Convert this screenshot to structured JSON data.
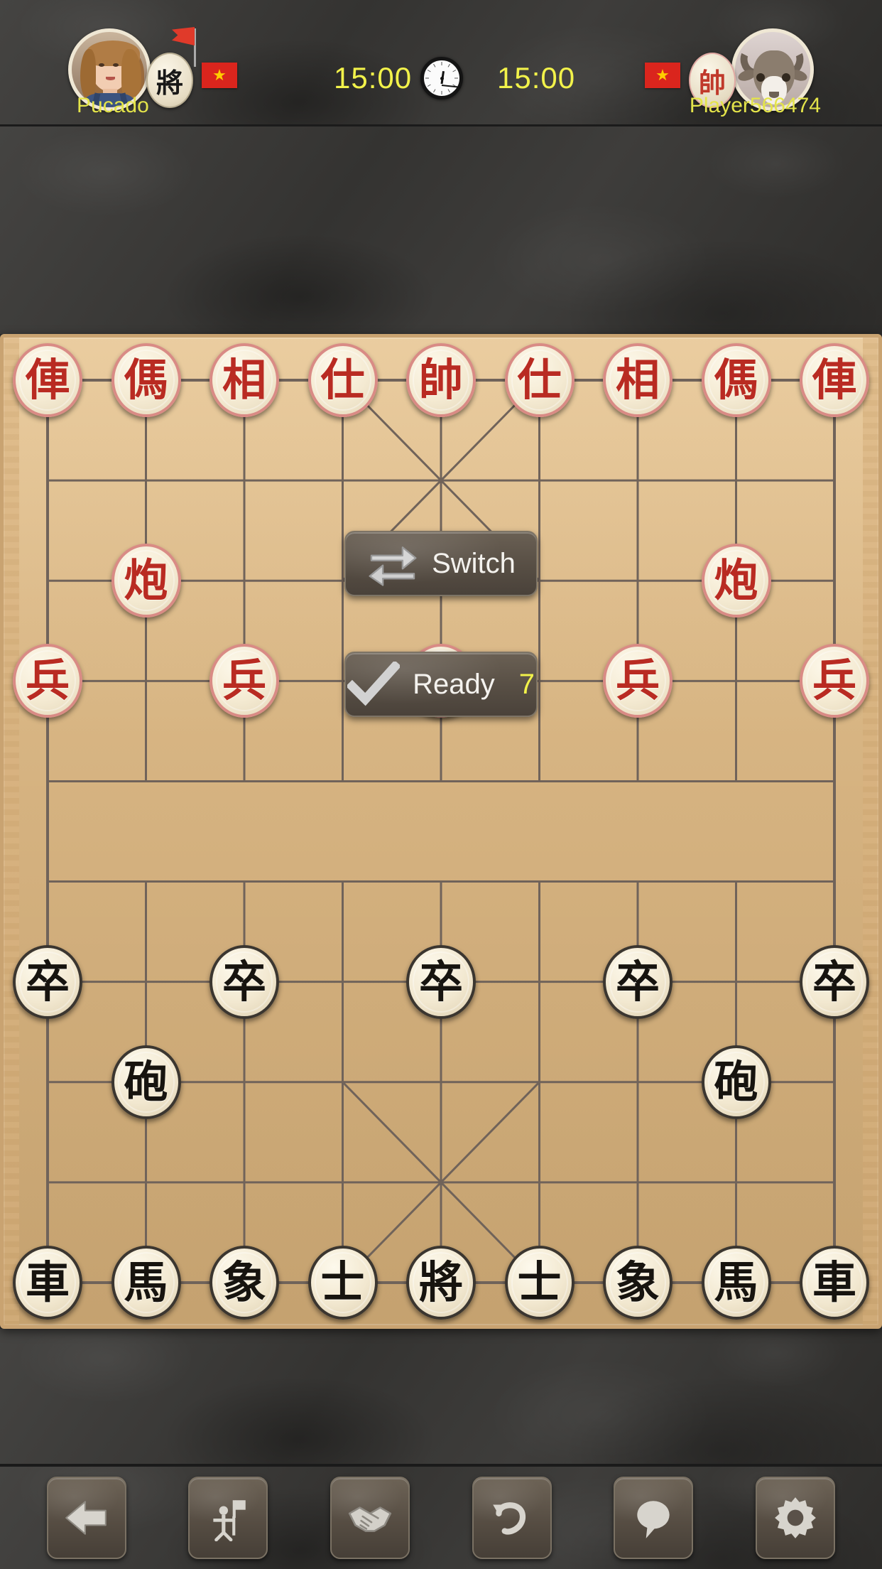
{
  "header": {
    "left_player": {
      "name": "Pucado",
      "rank_glyph": "將",
      "flag_star": "★",
      "avatar": "girl-avatar",
      "timer": "15:00"
    },
    "right_player": {
      "name": "Player566474",
      "rank_glyph": "帥",
      "flag_star": "★",
      "avatar": "ram-avatar",
      "timer": "15:00"
    },
    "clock_icon": "clock-icon"
  },
  "buttons": {
    "switch_label": "Switch",
    "switch_icon": "swap-arrows-icon",
    "ready_label": "Ready",
    "ready_icon": "check-icon",
    "ready_countdown": "7"
  },
  "toolbar": [
    {
      "name": "back-button",
      "icon": "back-arrow-icon"
    },
    {
      "name": "resign-button",
      "icon": "resign-flag-person-icon"
    },
    {
      "name": "draw-button",
      "icon": "handshake-icon"
    },
    {
      "name": "undo-button",
      "icon": "undo-arrow-icon"
    },
    {
      "name": "chat-button",
      "icon": "speech-bubble-icon"
    },
    {
      "name": "settings-button",
      "icon": "gear-icon"
    }
  ],
  "colors": {
    "timer_yellow": "#f2f24a",
    "name_yellow": "#e4e44a",
    "red_piece": "#b92b22",
    "black_piece": "#17140f",
    "board_wood": "#e2bd88",
    "slate_bg": "#3a3a38",
    "flag_red": "#da251d",
    "flag_star": "#ffcd00"
  },
  "board": {
    "columns": 9,
    "rows": 10,
    "pieces": [
      {
        "glyph": "俥",
        "side": "red",
        "col": 0,
        "row": 0
      },
      {
        "glyph": "傌",
        "side": "red",
        "col": 1,
        "row": 0
      },
      {
        "glyph": "相",
        "side": "red",
        "col": 2,
        "row": 0
      },
      {
        "glyph": "仕",
        "side": "red",
        "col": 3,
        "row": 0
      },
      {
        "glyph": "帥",
        "side": "red",
        "col": 4,
        "row": 0
      },
      {
        "glyph": "仕",
        "side": "red",
        "col": 5,
        "row": 0
      },
      {
        "glyph": "相",
        "side": "red",
        "col": 6,
        "row": 0
      },
      {
        "glyph": "傌",
        "side": "red",
        "col": 7,
        "row": 0
      },
      {
        "glyph": "俥",
        "side": "red",
        "col": 8,
        "row": 0
      },
      {
        "glyph": "炮",
        "side": "red",
        "col": 1,
        "row": 2
      },
      {
        "glyph": "炮",
        "side": "red",
        "col": 7,
        "row": 2
      },
      {
        "glyph": "兵",
        "side": "red",
        "col": 0,
        "row": 3
      },
      {
        "glyph": "兵",
        "side": "red",
        "col": 2,
        "row": 3
      },
      {
        "glyph": "兵",
        "side": "red",
        "col": 4,
        "row": 3
      },
      {
        "glyph": "兵",
        "side": "red",
        "col": 6,
        "row": 3
      },
      {
        "glyph": "兵",
        "side": "red",
        "col": 8,
        "row": 3
      },
      {
        "glyph": "卒",
        "side": "black",
        "col": 0,
        "row": 6
      },
      {
        "glyph": "卒",
        "side": "black",
        "col": 2,
        "row": 6
      },
      {
        "glyph": "卒",
        "side": "black",
        "col": 4,
        "row": 6
      },
      {
        "glyph": "卒",
        "side": "black",
        "col": 6,
        "row": 6
      },
      {
        "glyph": "卒",
        "side": "black",
        "col": 8,
        "row": 6
      },
      {
        "glyph": "砲",
        "side": "black",
        "col": 1,
        "row": 7
      },
      {
        "glyph": "砲",
        "side": "black",
        "col": 7,
        "row": 7
      },
      {
        "glyph": "車",
        "side": "black",
        "col": 0,
        "row": 9
      },
      {
        "glyph": "馬",
        "side": "black",
        "col": 1,
        "row": 9
      },
      {
        "glyph": "象",
        "side": "black",
        "col": 2,
        "row": 9
      },
      {
        "glyph": "士",
        "side": "black",
        "col": 3,
        "row": 9
      },
      {
        "glyph": "將",
        "side": "black",
        "col": 4,
        "row": 9
      },
      {
        "glyph": "士",
        "side": "black",
        "col": 5,
        "row": 9
      },
      {
        "glyph": "象",
        "side": "black",
        "col": 6,
        "row": 9
      },
      {
        "glyph": "馬",
        "side": "black",
        "col": 7,
        "row": 9
      },
      {
        "glyph": "車",
        "side": "black",
        "col": 8,
        "row": 9
      }
    ]
  }
}
